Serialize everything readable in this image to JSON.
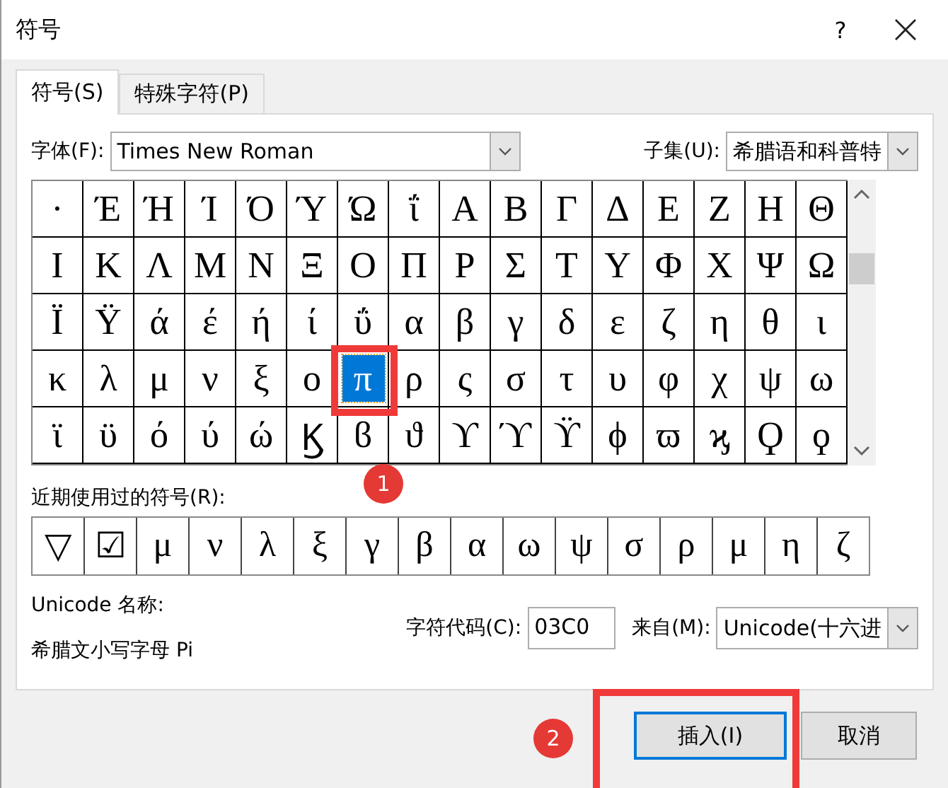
{
  "window": {
    "title": "符号",
    "help": "?"
  },
  "tabs": [
    {
      "label": "符号(S)",
      "selected": true
    },
    {
      "label": "特殊字符(P)",
      "selected": false
    }
  ],
  "font": {
    "label": "字体(F):",
    "value": "Times New Roman"
  },
  "subset": {
    "label": "子集(U):",
    "value": "希腊语和科普特"
  },
  "symbol_grid": {
    "rows": [
      [
        {
          "char": "·",
          "selected": false
        },
        {
          "char": "Έ",
          "selected": false
        },
        {
          "char": "Ή",
          "selected": false
        },
        {
          "char": "Ί",
          "selected": false
        },
        {
          "char": "Ό",
          "selected": false
        },
        {
          "char": "Ύ",
          "selected": false
        },
        {
          "char": "Ώ",
          "selected": false
        },
        {
          "char": "ΐ",
          "selected": false
        },
        {
          "char": "Α",
          "selected": false
        },
        {
          "char": "Β",
          "selected": false
        },
        {
          "char": "Γ",
          "selected": false
        },
        {
          "char": "Δ",
          "selected": false
        },
        {
          "char": "Ε",
          "selected": false
        },
        {
          "char": "Ζ",
          "selected": false
        },
        {
          "char": "Η",
          "selected": false
        },
        {
          "char": "Θ",
          "selected": false
        }
      ],
      [
        {
          "char": "Ι",
          "selected": false
        },
        {
          "char": "Κ",
          "selected": false
        },
        {
          "char": "Λ",
          "selected": false
        },
        {
          "char": "Μ",
          "selected": false
        },
        {
          "char": "Ν",
          "selected": false
        },
        {
          "char": "Ξ",
          "selected": false
        },
        {
          "char": "Ο",
          "selected": false
        },
        {
          "char": "Π",
          "selected": false
        },
        {
          "char": "Ρ",
          "selected": false
        },
        {
          "char": "Σ",
          "selected": false
        },
        {
          "char": "Τ",
          "selected": false
        },
        {
          "char": "Υ",
          "selected": false
        },
        {
          "char": "Φ",
          "selected": false
        },
        {
          "char": "Χ",
          "selected": false
        },
        {
          "char": "Ψ",
          "selected": false
        },
        {
          "char": "Ω",
          "selected": false
        }
      ],
      [
        {
          "char": "Ϊ",
          "selected": false
        },
        {
          "char": "Ϋ",
          "selected": false
        },
        {
          "char": "ά",
          "selected": false
        },
        {
          "char": "έ",
          "selected": false
        },
        {
          "char": "ή",
          "selected": false
        },
        {
          "char": "ί",
          "selected": false
        },
        {
          "char": "ΰ",
          "selected": false
        },
        {
          "char": "α",
          "selected": false
        },
        {
          "char": "β",
          "selected": false
        },
        {
          "char": "γ",
          "selected": false
        },
        {
          "char": "δ",
          "selected": false
        },
        {
          "char": "ε",
          "selected": false
        },
        {
          "char": "ζ",
          "selected": false
        },
        {
          "char": "η",
          "selected": false
        },
        {
          "char": "θ",
          "selected": false
        },
        {
          "char": "ι",
          "selected": false
        }
      ],
      [
        {
          "char": "κ",
          "selected": false
        },
        {
          "char": "λ",
          "selected": false
        },
        {
          "char": "μ",
          "selected": false
        },
        {
          "char": "ν",
          "selected": false
        },
        {
          "char": "ξ",
          "selected": false
        },
        {
          "char": "ο",
          "selected": false
        },
        {
          "char": "π",
          "selected": true
        },
        {
          "char": "ρ",
          "selected": false
        },
        {
          "char": "ς",
          "selected": false
        },
        {
          "char": "σ",
          "selected": false
        },
        {
          "char": "τ",
          "selected": false
        },
        {
          "char": "υ",
          "selected": false
        },
        {
          "char": "φ",
          "selected": false
        },
        {
          "char": "χ",
          "selected": false
        },
        {
          "char": "ψ",
          "selected": false
        },
        {
          "char": "ω",
          "selected": false
        }
      ],
      [
        {
          "char": "ϊ",
          "selected": false
        },
        {
          "char": "ϋ",
          "selected": false
        },
        {
          "char": "ό",
          "selected": false
        },
        {
          "char": "ύ",
          "selected": false
        },
        {
          "char": "ώ",
          "selected": false
        },
        {
          "char": "Ϗ",
          "selected": false
        },
        {
          "char": "ϐ",
          "selected": false
        },
        {
          "char": "ϑ",
          "selected": false
        },
        {
          "char": "ϒ",
          "selected": false
        },
        {
          "char": "ϓ",
          "selected": false
        },
        {
          "char": "ϔ",
          "selected": false
        },
        {
          "char": "ϕ",
          "selected": false
        },
        {
          "char": "ϖ",
          "selected": false
        },
        {
          "char": "ϗ",
          "selected": false
        },
        {
          "char": "Ϙ",
          "selected": false
        },
        {
          "char": "ϙ",
          "selected": false
        }
      ]
    ]
  },
  "recent": {
    "label": "近期使用过的符号(R):",
    "symbols": [
      "▽",
      "☑",
      "μ",
      "ν",
      "λ",
      "ξ",
      "γ",
      "β",
      "α",
      "ω",
      "ψ",
      "σ",
      "ρ",
      "μ",
      "η",
      "ζ"
    ]
  },
  "unicode_name": {
    "label": "Unicode 名称:",
    "value": "希腊文小写字母 Pi"
  },
  "char_code": {
    "label": "字符代码(C):",
    "value": "03C0"
  },
  "from": {
    "label": "来自(M):",
    "value": "Unicode(十六进"
  },
  "buttons": [
    {
      "label": "插入(I)",
      "kind": "default"
    },
    {
      "label": "取消",
      "kind": "normal"
    }
  ],
  "annotations": [
    {
      "label": "1"
    },
    {
      "label": "2"
    }
  ]
}
